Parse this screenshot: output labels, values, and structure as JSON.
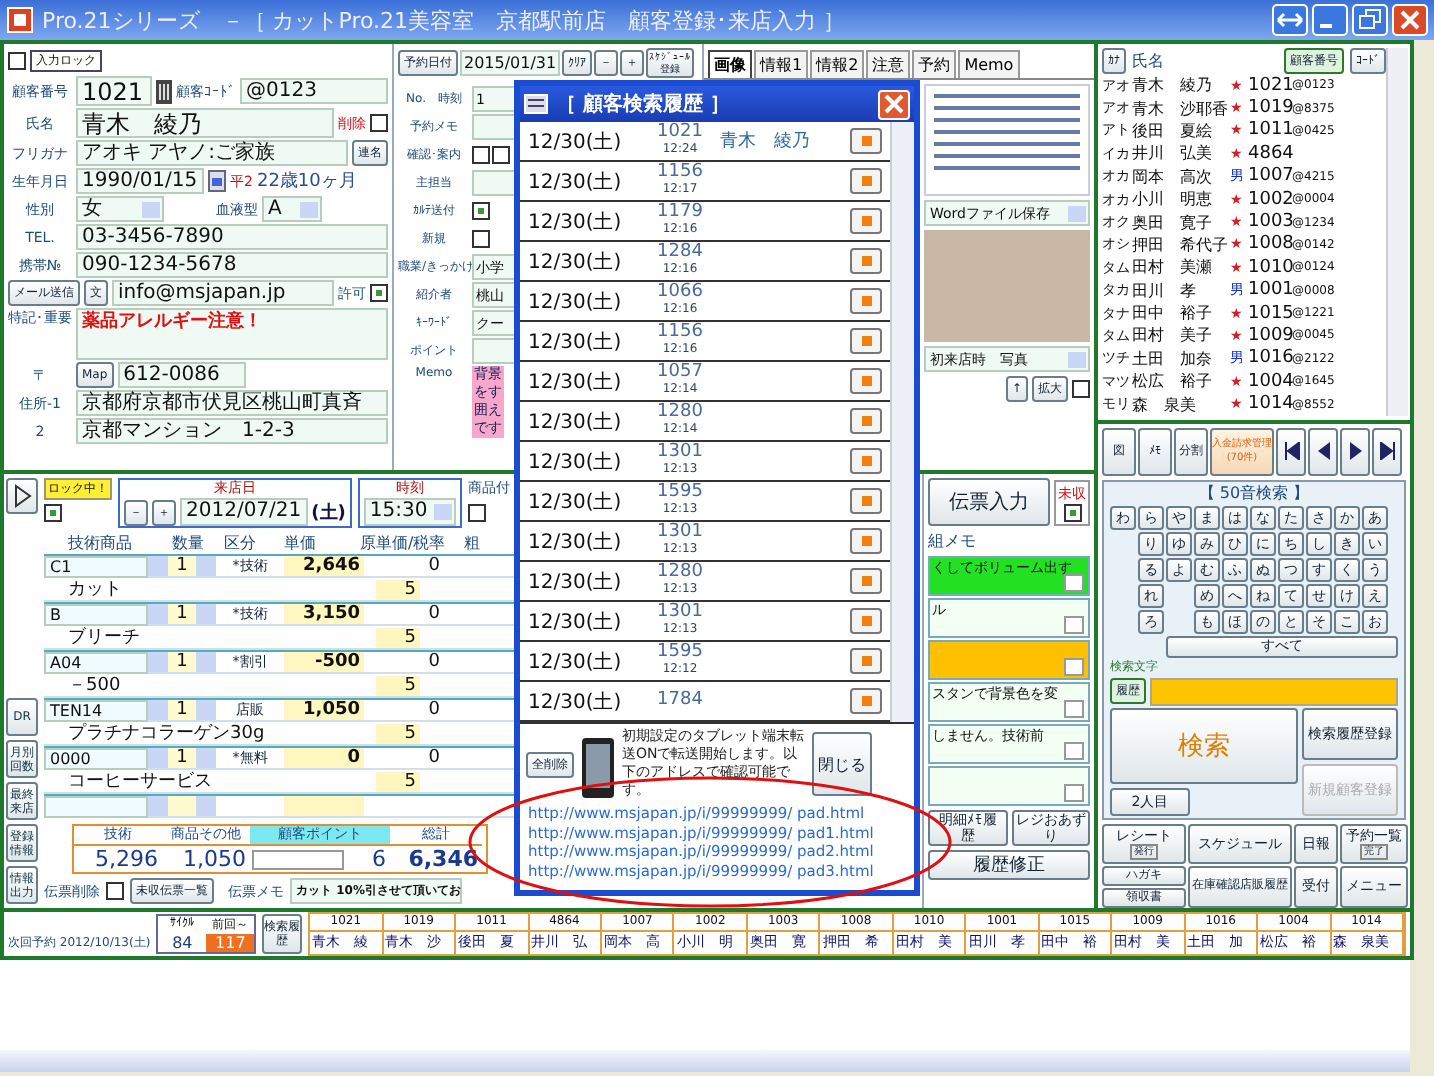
{
  "window": {
    "title": "Pro.21シリーズ　－［ カットPro.21美容室　京都駅前店　顧客登録･来店入力 ］"
  },
  "customer": {
    "input_lock": {
      "label": "入力ロック",
      "checked": false
    },
    "number_label": "顧客番号",
    "number": "1021",
    "code_label": "顧客ｺｰﾄﾞ",
    "code": "@0123",
    "name_label": "氏名",
    "name": "青木　綾乃",
    "delete": {
      "label": "削除",
      "checked": false
    },
    "kana_label": "フリガナ",
    "kana": "アオキ アヤノ:ご家族",
    "joint_button": "連名",
    "birth_label": "生年月日",
    "birth": "1990/01/15",
    "era": "平2",
    "age": "22歳10ヶ月",
    "sex_label": "性別",
    "sex": "女",
    "blood_label": "血液型",
    "blood": "A",
    "tel_label": "TEL.",
    "tel": "03-3456-7890",
    "mobile_label": "携帯№",
    "mobile": "090-1234-5678",
    "mail_button": "メール送信",
    "text_button": "文",
    "email": "info@msjapan.jp",
    "permit": {
      "label": "許可",
      "checked": true
    },
    "note_label": "特記･重要",
    "note": "薬品アレルギー注意！",
    "zip_label": "〒",
    "map_button": "Map",
    "zip": "612-0086",
    "address1_label": "住所-1",
    "address1": "京都府京都市伏見区桃山町真斉",
    "address2_label": "2",
    "address2": "京都マンション　1-2-3"
  },
  "reservation": {
    "date_button": "予約日付",
    "date": "2015/01/31",
    "clear_button": "ｸﾘｱ",
    "minus_button": "－",
    "plus_button": "＋",
    "schedule_button": "ｽｹｼﾞｭｰﾙ登録",
    "rows": [
      {
        "kind": "select",
        "label": "No.　時刻",
        "value": "1"
      },
      {
        "kind": "text",
        "label": "予約メモ"
      },
      {
        "kind": "checks",
        "label": "確認･案内",
        "checks": [
          false,
          false
        ]
      },
      {
        "kind": "text",
        "label": "主担当"
      },
      {
        "kind": "check",
        "label": "ｶﾙﾃ送付",
        "checked": true
      },
      {
        "kind": "check",
        "label": "新規",
        "checked": false
      },
      {
        "kind": "text",
        "label": "職業/きっかけ",
        "value": "小学"
      },
      {
        "kind": "text",
        "label": "紹介者",
        "value": "桃山"
      },
      {
        "kind": "text",
        "label": "ｷｰﾜｰﾄﾞ",
        "value": "クー"
      },
      {
        "kind": "text",
        "label": "ポイント"
      },
      {
        "kind": "memo",
        "label": "Memo",
        "value": "背景をす囲えです"
      }
    ]
  },
  "tabs": [
    {
      "label": "画像",
      "selected": true
    },
    {
      "label": "情報1",
      "selected": false
    },
    {
      "label": "情報2",
      "selected": false
    },
    {
      "label": "注意",
      "selected": false
    },
    {
      "label": "予約",
      "selected": false
    },
    {
      "label": "Memo",
      "selected": false
    }
  ],
  "image_tab": {
    "document_select": "Wordファイル保存",
    "photo_select": "初来店時　写真",
    "up_button": "↑",
    "zoom_button": "拡大",
    "zoom_checked": false
  },
  "customer_list": {
    "kana_button": "ｶﾅ",
    "name_header": "氏名",
    "number_button": "顧客番号",
    "code_button": "ｺｰﾄﾞ",
    "rows": [
      {
        "kana": "アオ",
        "name": "青木　綾乃",
        "kind": "female",
        "mark": "★",
        "number": "1021",
        "code": "@0123"
      },
      {
        "kana": "アオ",
        "name": "青木　沙耶香",
        "kind": "female",
        "mark": "★",
        "number": "1019",
        "code": "@8375"
      },
      {
        "kana": "アト",
        "name": "後田　夏絵",
        "kind": "female",
        "mark": "★",
        "number": "1011",
        "code": "@0425"
      },
      {
        "kana": "イカ",
        "name": "井川　弘美",
        "kind": "female",
        "mark": "★",
        "number": "4864"
      },
      {
        "kana": "オカ",
        "name": "岡本　高次",
        "kind": "male",
        "mark": "男",
        "number": "1007",
        "code": "@4215"
      },
      {
        "kana": "オカ",
        "name": "小川　明恵",
        "kind": "female",
        "mark": "★",
        "number": "1002",
        "code": "@0004"
      },
      {
        "kana": "オク",
        "name": "奥田　寛子",
        "kind": "female",
        "mark": "★",
        "number": "1003",
        "code": "@1234"
      },
      {
        "kana": "オシ",
        "name": "押田　希代子",
        "kind": "female",
        "mark": "★",
        "number": "1008",
        "code": "@0142"
      },
      {
        "kana": "タム",
        "name": "田村　美瀬",
        "kind": "female",
        "mark": "★",
        "number": "1010",
        "code": "@0124"
      },
      {
        "kana": "タカ",
        "name": "田川　孝",
        "kind": "male",
        "mark": "男",
        "number": "1001",
        "code": "@0008"
      },
      {
        "kana": "タナ",
        "name": "田中　裕子",
        "kind": "female",
        "mark": "★",
        "number": "1015",
        "code": "@1221"
      },
      {
        "kana": "タム",
        "name": "田村　美子",
        "kind": "female",
        "mark": "★",
        "number": "1009",
        "code": "@0045"
      },
      {
        "kana": "ツチ",
        "name": "土田　加奈",
        "kind": "male",
        "mark": "男",
        "number": "1016",
        "code": "@2122"
      },
      {
        "kana": "マツ",
        "name": "松広　裕子",
        "kind": "female",
        "mark": "★",
        "number": "1004",
        "code": "@1645"
      },
      {
        "kana": "モリ",
        "name": "森　泉美",
        "kind": "female",
        "mark": "★",
        "number": "1014",
        "code": "@8552"
      }
    ]
  },
  "visit": {
    "lock": {
      "label": "ロック中！",
      "checked": true
    },
    "date_label": "来店日",
    "minus_button": "－",
    "plus_button": "＋",
    "date": "2012/07/21",
    "weekday": "(土)",
    "time_label": "時刻",
    "time": "15:30",
    "goods_label": "商品付",
    "goods_checked": false,
    "columns": [
      "技術商品",
      "数量",
      "区分",
      "単価",
      "原単価/税率",
      "粗"
    ],
    "items": [
      {
        "code": "C1",
        "qty": "1",
        "type": "*技術",
        "price": "2,646",
        "cost": "0",
        "name": "カット",
        "tax": "5"
      },
      {
        "code": "B",
        "qty": "1",
        "type": "*技術",
        "price": "3,150",
        "cost": "0",
        "name": "ブリーチ",
        "tax": "5"
      },
      {
        "code": "A04",
        "qty": "1",
        "type": "*割引",
        "price": "-500",
        "cost": "0",
        "name": "－500",
        "tax": "5"
      },
      {
        "code": "TEN14",
        "qty": "1",
        "type": "店販",
        "price": "1,050",
        "cost": "0",
        "name": "プラチナコラーゲン30g",
        "tax": "5"
      },
      {
        "code": "0000",
        "qty": "1",
        "type": "*無料",
        "price": "0",
        "cost": "0",
        "name": "コーヒーサービス",
        "tax": "5"
      }
    ],
    "totals": [
      {
        "label": "技術",
        "value": "5,296"
      },
      {
        "label": "商品その他",
        "value": "1,050"
      },
      {
        "label": "顧客ポイント",
        "value": "6",
        "kind": "points"
      },
      {
        "label": "総計",
        "value": "6,346"
      }
    ],
    "slip_delete": {
      "label": "伝票削除",
      "checked": false
    },
    "unpaid_list_button": "未収伝票一覧",
    "slip_memo_label": "伝票メモ",
    "slip_memo": "カット 10%引させて頂いてお",
    "side_buttons": [
      "DR",
      "月別回数",
      "最終来店",
      "登録情報",
      "情報出力"
    ],
    "slip_button": "伝票入力",
    "unpaid": {
      "label": "未収",
      "checked": true
    },
    "memo_label": "組メモ",
    "memos": [
      {
        "color": "#22e022",
        "text": "くしてボリューム出す"
      },
      {
        "color": "#f2fff2",
        "text": "ル"
      },
      {
        "color": "#ffc000"
      },
      {
        "color": "#f2fff2",
        "text": "スタンで背景色を変"
      },
      {
        "color": "#f2fff2",
        "text": "しません。技術前"
      },
      {
        "color": "#f2fff2"
      }
    ],
    "detail_memo_button": "明細ﾒﾓ履歴",
    "register_button": "レジおあずり",
    "history_fix_button": "履歴修正"
  },
  "controls": {
    "top_buttons": [
      "図",
      "ﾒﾓ",
      "分割",
      "入金請求管理(70件)"
    ],
    "kana_title": "【 50音検索 】",
    "kana_rows": [
      [
        "わ",
        "ら",
        "や",
        "ま",
        "は",
        "な",
        "た",
        "さ",
        "か",
        "あ"
      ],
      [
        null,
        "り",
        "ゆ",
        "み",
        "ひ",
        "に",
        "ち",
        "し",
        "き",
        "い"
      ],
      [
        null,
        "る",
        "よ",
        "む",
        "ふ",
        "ぬ",
        "つ",
        "す",
        "く",
        "う"
      ],
      [
        null,
        "れ",
        null,
        "め",
        "へ",
        "ね",
        "て",
        "せ",
        "け",
        "え"
      ],
      [
        null,
        "ろ",
        null,
        "も",
        "ほ",
        "の",
        "と",
        "そ",
        "こ",
        "お"
      ]
    ],
    "all_button": "すべて",
    "search_label": "検索文字",
    "history_button": "履歴",
    "search_button": "検索",
    "second_button": "2人目",
    "save_history_button": "検索履歴登録",
    "new_customer": {
      "label": "新規顧客登録",
      "disabled": true
    },
    "bottom_buttons": [
      {
        "label": "レシート",
        "sub": "発行"
      },
      {
        "label": "スケジュール"
      },
      {
        "label": "日報"
      },
      {
        "label": "予約一覧",
        "sub": "完了"
      },
      {
        "label": "ハガキ"
      },
      {
        "label": "領収書"
      },
      {
        "label": "在庫確認店販履歴"
      },
      {
        "label": "受付"
      },
      {
        "label": "メニュー"
      }
    ]
  },
  "status": {
    "next_label": "次回予約",
    "next_date": "2012/10/13(土)",
    "cycle_label": "ｻｲｸﾙ",
    "cycle": "84",
    "since_label": "前回～",
    "since": "117",
    "history_button": "検索履歴",
    "recent": [
      {
        "number": "1021",
        "name": "青木　綾"
      },
      {
        "number": "1019",
        "name": "青木　沙"
      },
      {
        "number": "1011",
        "name": "後田　夏"
      },
      {
        "number": "4864",
        "name": "井川　弘"
      },
      {
        "number": "1007",
        "name": "岡本　高"
      },
      {
        "number": "1002",
        "name": "小川　明"
      },
      {
        "number": "1003",
        "name": "奥田　寛"
      },
      {
        "number": "1008",
        "name": "押田　希"
      },
      {
        "number": "1010",
        "name": "田村　美"
      },
      {
        "number": "1001",
        "name": "田川　孝"
      },
      {
        "number": "1015",
        "name": "田中　裕"
      },
      {
        "number": "1009",
        "name": "田村　美"
      },
      {
        "number": "1016",
        "name": "土田　加"
      },
      {
        "number": "1004",
        "name": "松広　裕"
      },
      {
        "number": "1014",
        "name": "森　泉美"
      }
    ]
  },
  "history_dialog": {
    "title": "［ 顧客検索履歴 ］",
    "rows": [
      {
        "date": "12/30(土)",
        "number": "1021",
        "time": "12:24",
        "name": "青木　綾乃"
      },
      {
        "date": "12/30(土)",
        "number": "1156",
        "time": "12:17"
      },
      {
        "date": "12/30(土)",
        "number": "1179",
        "time": "12:16"
      },
      {
        "date": "12/30(土)",
        "number": "1284",
        "time": "12:16"
      },
      {
        "date": "12/30(土)",
        "number": "1066",
        "time": "12:16"
      },
      {
        "date": "12/30(土)",
        "number": "1156",
        "time": "12:16"
      },
      {
        "date": "12/30(土)",
        "number": "1057",
        "time": "12:14"
      },
      {
        "date": "12/30(土)",
        "number": "1280",
        "time": "12:14"
      },
      {
        "date": "12/30(土)",
        "number": "1301",
        "time": "12:13"
      },
      {
        "date": "12/30(土)",
        "number": "1595",
        "time": "12:13"
      },
      {
        "date": "12/30(土)",
        "number": "1301",
        "time": "12:13"
      },
      {
        "date": "12/30(土)",
        "number": "1280",
        "time": "12:13"
      },
      {
        "date": "12/30(土)",
        "number": "1301",
        "time": "12:13"
      },
      {
        "date": "12/30(土)",
        "number": "1595",
        "time": "12:12"
      },
      {
        "date": "12/30(土)",
        "number": "1784"
      }
    ],
    "delete_all_button": "全削除",
    "message": "初期設定のタブレット端末転送ONで転送開始します。以下のアドレスで確認可能です。",
    "close_button": "閉じる",
    "links": [
      "http://www.msjapan.jp/i/99999999/ pad.html",
      "http://www.msjapan.jp/i/99999999/ pad1.html",
      "http://www.msjapan.jp/i/99999999/ pad2.html",
      "http://www.msjapan.jp/i/99999999/ pad3.html"
    ]
  }
}
